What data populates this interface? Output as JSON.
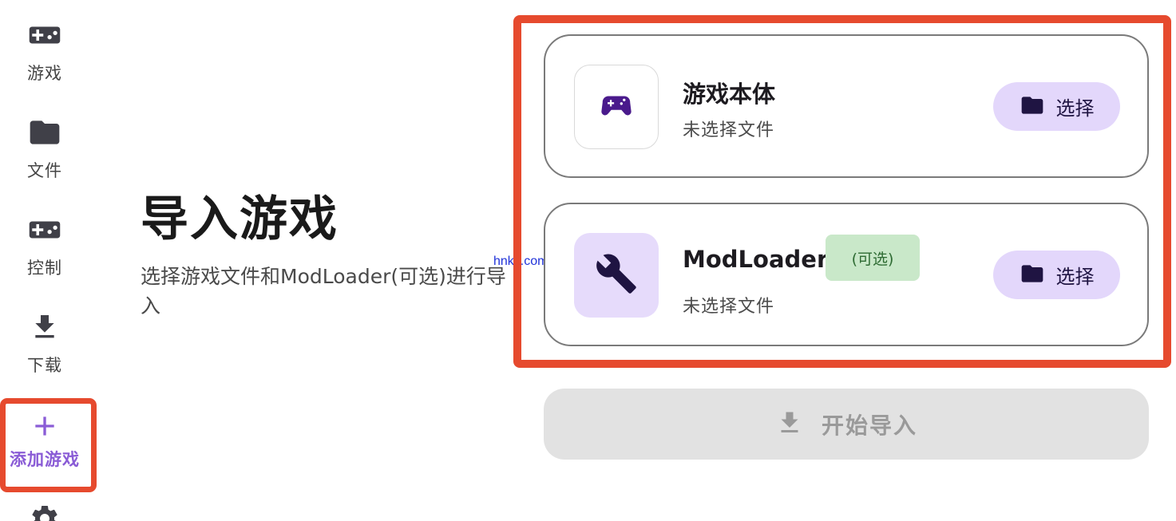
{
  "sidebar": {
    "items": [
      {
        "label": "游戏",
        "icon": "gamepad-icon"
      },
      {
        "label": "文件",
        "icon": "folder-icon"
      },
      {
        "label": "控制",
        "icon": "gamepad-icon"
      },
      {
        "label": "下载",
        "icon": "download-icon"
      },
      {
        "label": "添加游戏",
        "icon": "plus-icon",
        "active": true
      },
      {
        "label": "",
        "icon": "gear-icon"
      }
    ],
    "active_color": "#8a5cd6"
  },
  "main": {
    "title": "导入游戏",
    "description": "选择游戏文件和ModLoader(可选)进行导入"
  },
  "watermark": "hnkjr.com",
  "cards": [
    {
      "title": "游戏本体",
      "status": "未选择文件",
      "icon": "gamepad-icon",
      "button_label": "选择"
    },
    {
      "title": "ModLoader",
      "badge": "(可选)",
      "status": "未选择文件",
      "icon": "wrench-icon",
      "button_label": "选择"
    }
  ],
  "start_button": {
    "label": "开始导入",
    "icon": "download-icon",
    "enabled": false
  },
  "colors": {
    "highlight": "#e64a2e",
    "accent_purple": "#4a1a8c",
    "button_tint": "#e3d7fb",
    "badge_green": "#c9e8c9"
  }
}
